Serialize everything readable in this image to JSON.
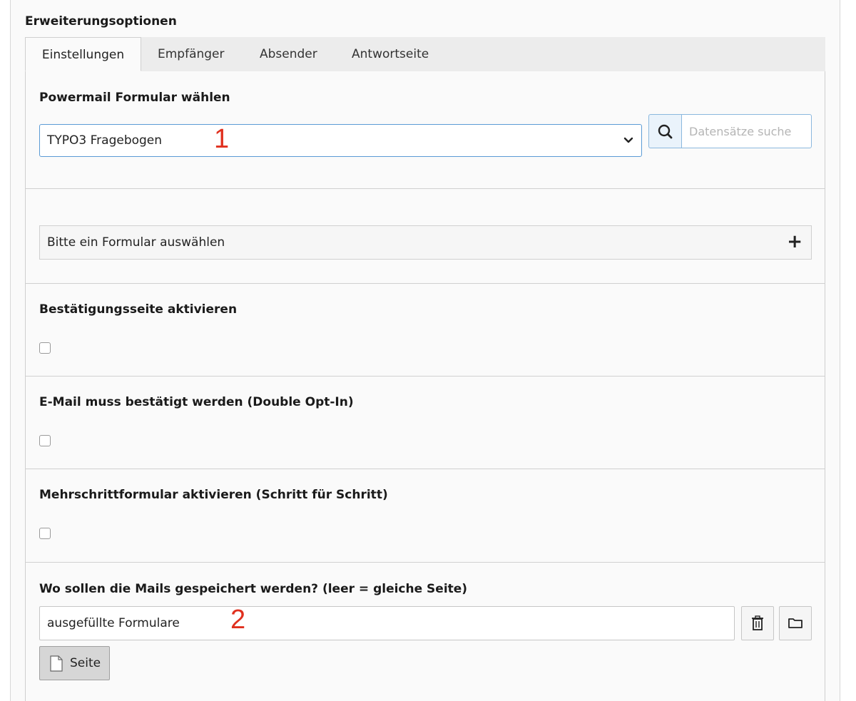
{
  "section": {
    "title": "Erweiterungsoptionen"
  },
  "tabs": [
    {
      "label": "Einstellungen",
      "active": true
    },
    {
      "label": "Empfänger",
      "active": false
    },
    {
      "label": "Absender",
      "active": false
    },
    {
      "label": "Antwortseite",
      "active": false
    }
  ],
  "form_select": {
    "label": "Powermail Formular wählen",
    "value": "TYPO3 Fragebogen",
    "annotation": "1"
  },
  "search": {
    "placeholder": "Datensätze suche",
    "icon": "search-icon"
  },
  "form_collapse": {
    "label": "Bitte ein Formular auswählen",
    "toggle": "+"
  },
  "confirmation_page": {
    "label": "Bestätigungsseite aktivieren",
    "checked": false
  },
  "double_opt_in": {
    "label": "E-Mail muss bestätigt werden (Double Opt-In)",
    "checked": false
  },
  "multistep": {
    "label": "Mehrschrittformular aktivieren (Schritt für Schritt)",
    "checked": false
  },
  "storage": {
    "label": "Wo sollen die Mails gespeichert werden? (leer = gleiche Seite)",
    "value": "ausgefüllte Formulare",
    "annotation": "2",
    "delete_icon": "trash-icon",
    "browse_icon": "folder-icon",
    "page_button_label": "Seite"
  },
  "colors": {
    "annotation": "#e0301e",
    "focus_border": "#5b9bd5"
  }
}
